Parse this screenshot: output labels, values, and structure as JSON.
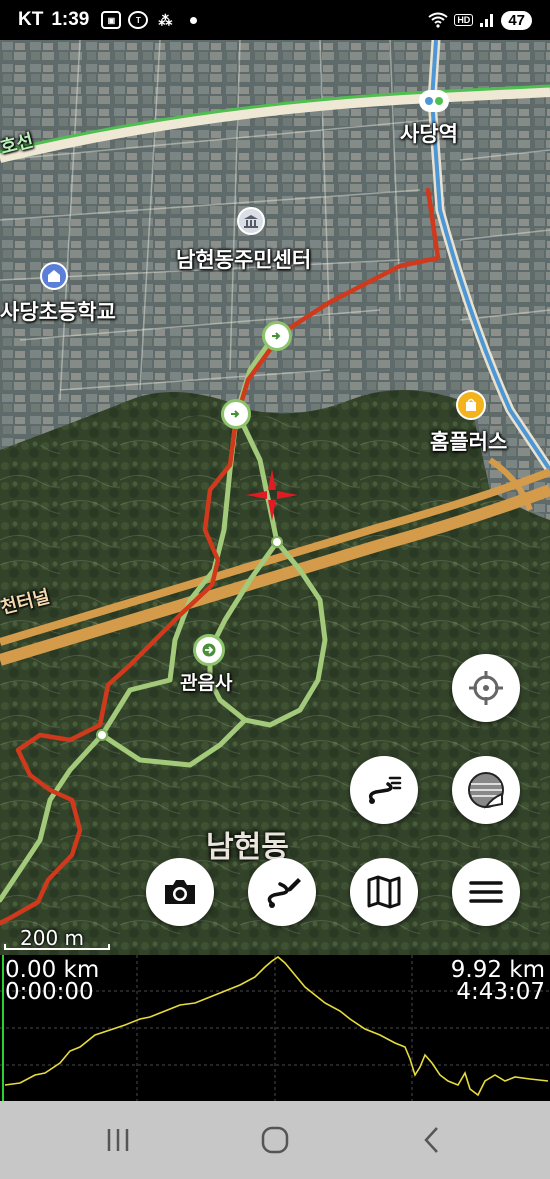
{
  "status_bar": {
    "carrier": "KT",
    "time": "1:39",
    "left_icons": [
      "screenshot-icon",
      "talk-icon",
      "app-icon",
      "notification-dot"
    ],
    "right_icons": [
      "wifi-icon",
      "hd-icon",
      "signal-icon"
    ],
    "hd_label": "HD",
    "battery": "47"
  },
  "map": {
    "labels": {
      "station": "사당역",
      "community_center": "남현동주민센터",
      "school": "사당초등학교",
      "homeplus": "홈플러스",
      "temple": "관음사",
      "district": "남현동",
      "tunnel": "천터널",
      "subway_line": "호선"
    },
    "poi_icons": [
      "subway-station-icon",
      "building-icon",
      "school-icon",
      "shopping-icon",
      "temple-icon"
    ],
    "scale_label": "200 m",
    "colors": {
      "track": "#d0391b",
      "trail": "#a3c97a",
      "road": "#d49b4a",
      "subway": "#5aa0d8",
      "crosshair": "#e01b24"
    }
  },
  "buttons": {
    "locate": "locate-icon",
    "route_list": "route-list-icon",
    "map_layer": "layer-icon",
    "camera": "camera-icon",
    "route_edit": "route-edit-icon",
    "map": "map-icon",
    "menu": "menu-icon"
  },
  "elevation": {
    "start_distance": "0.00 km",
    "start_time": "0:00:00",
    "end_distance": "9.92 km",
    "end_time": "4:43:07",
    "line_color": "#e6dc3c"
  },
  "nav_bar": {
    "icons": [
      "recent-apps-icon",
      "home-icon",
      "back-icon"
    ]
  }
}
